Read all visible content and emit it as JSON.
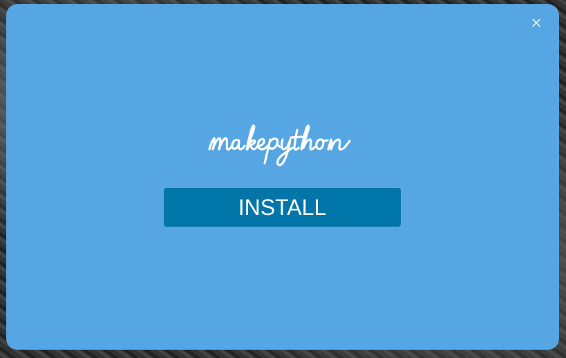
{
  "logo": {
    "text": "makepython"
  },
  "dialog": {
    "install_label": "INSTALL",
    "close_icon": "close-icon"
  },
  "colors": {
    "dialog_bg": "#56a6e3",
    "button_bg": "#0075a8",
    "text": "#ffffff"
  }
}
